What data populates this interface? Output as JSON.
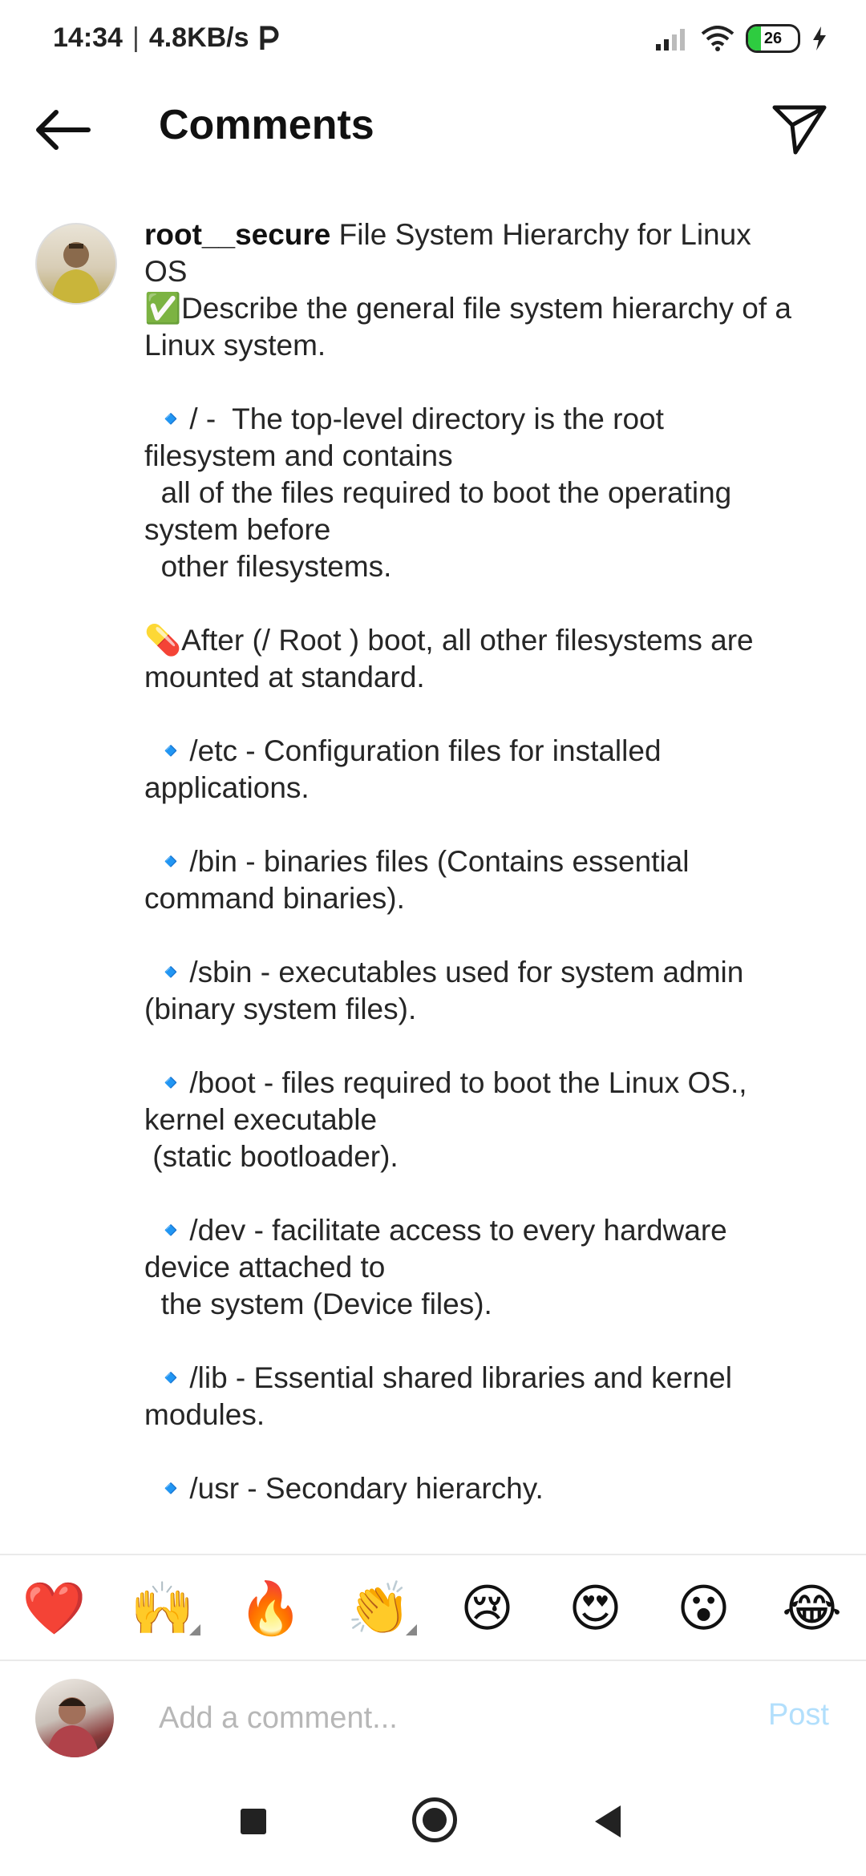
{
  "status_bar": {
    "time": "14:34",
    "speed": "4.8KB/s",
    "battery_level": "26",
    "battery_fraction": 0.26
  },
  "header": {
    "title": "Comments",
    "back_icon": "arrow-left-icon",
    "send_icon": "paper-plane-icon"
  },
  "comment": {
    "username": "root__secure",
    "text": " File System Hierarchy for Linux OS\n✅Describe the general file system hierarchy of a Linux system.\n\n 🔹/ -  The top-level directory is the root filesystem and contains\n  all of the files required to boot the operating system before\n  other filesystems.\n\n💊After (/ Root ) boot, all other filesystems are mounted at standard.\n\n 🔹/etc - Configuration files for installed applications.\n\n 🔹/bin - binaries files (Contains essential command binaries).\n\n 🔹/sbin - executables used for system admin (binary system files).\n\n 🔹/boot - files required to boot the Linux OS., kernel executable\n (static bootloader).\n\n 🔹/dev - facilitate access to every hardware device attached to\n  the system (Device files).\n\n 🔹/lib - Essential shared libraries and kernel modules.\n\n 🔹/usr - Secondary hierarchy."
  },
  "emoji_bar": {
    "items": [
      "❤️",
      "🙌",
      "🔥",
      "👏",
      "😢",
      "😍",
      "😮",
      "😂"
    ]
  },
  "composer": {
    "placeholder": "Add a comment...",
    "post_label": "Post"
  },
  "colors": {
    "post_disabled": "#b2dffc",
    "battery_fill": "#2ecc40"
  }
}
